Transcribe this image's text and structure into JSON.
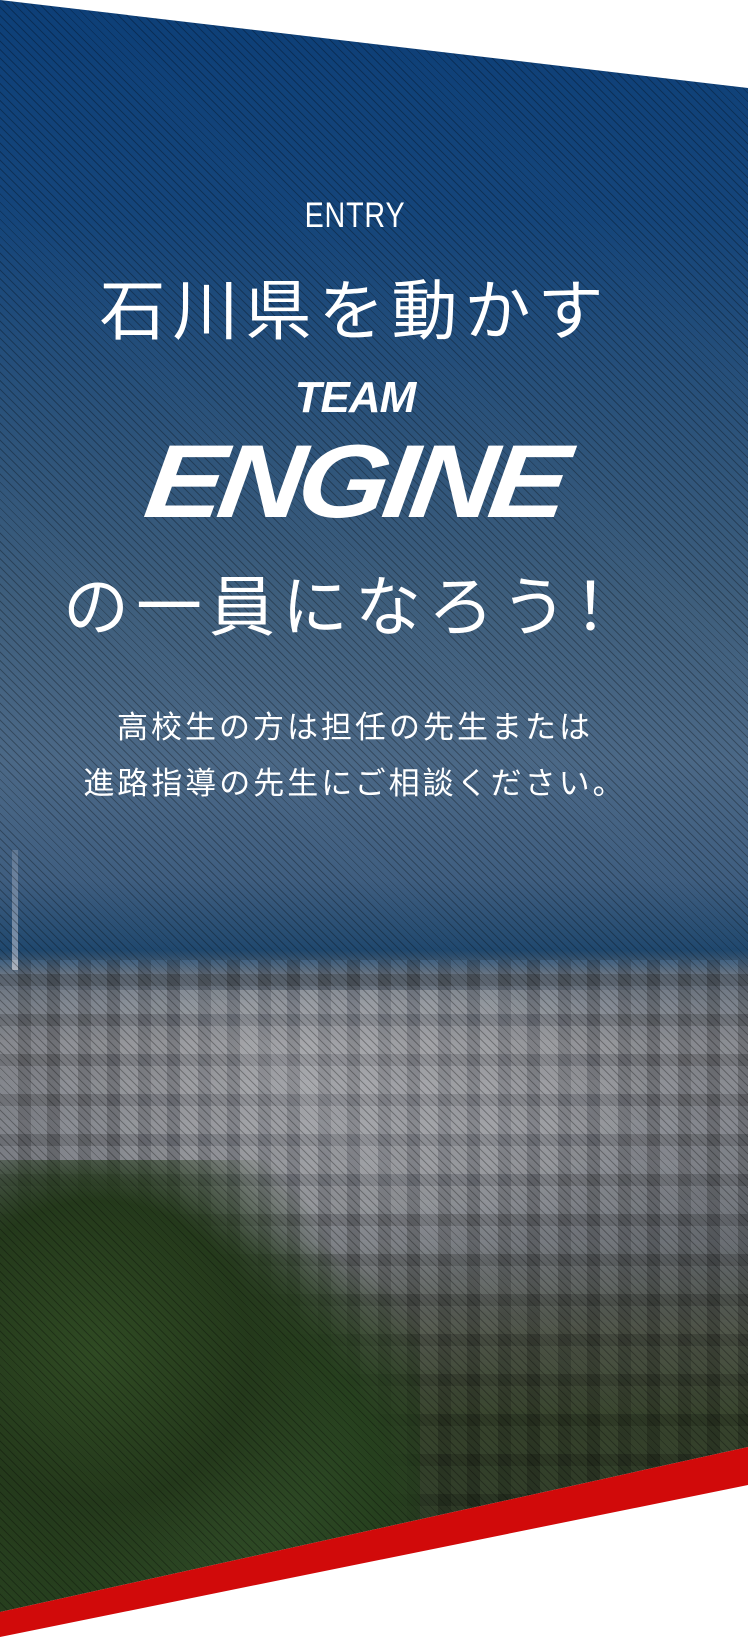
{
  "section": {
    "eyebrow": "ENTRY",
    "headline_line1": "石川県を動かす",
    "logo": {
      "team": "TEAM",
      "engine": "ENGINE"
    },
    "headline_line2": "の一員になろう！",
    "note_line1": "高校生の方は担任の先生または",
    "note_line2": "進路指導の先生にご相談ください。"
  },
  "colors": {
    "panel_top": "#0d3f78",
    "accent_red": "#d10a0a",
    "text": "#ffffff"
  },
  "background": {
    "image": "city-skyline-photo",
    "overlay": "diagonal-stripes"
  }
}
